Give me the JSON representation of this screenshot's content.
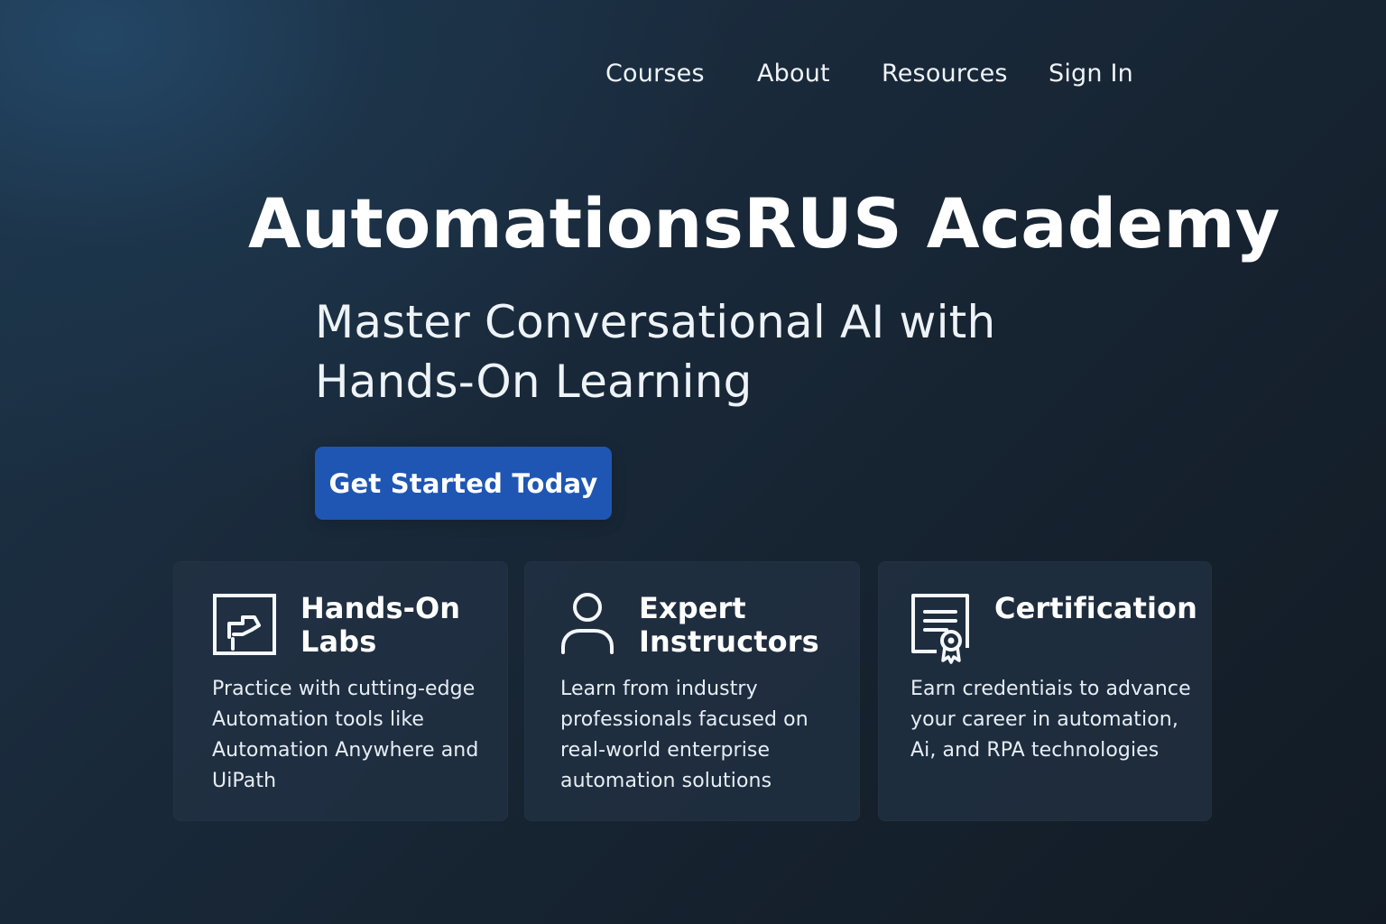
{
  "nav": {
    "items": [
      {
        "label": "Courses"
      },
      {
        "label": "About"
      },
      {
        "label": "Resources"
      },
      {
        "label": "Sign In"
      }
    ]
  },
  "hero": {
    "title": "AutomationsRUS Academy",
    "subtitle": "Master Conversational AI with Hands-On Learning",
    "cta_label": "Get Started Today"
  },
  "features": [
    {
      "icon": "lab-icon",
      "title": "Hands-On Labs",
      "description": "Practice with cutting-edge Automation tools like Automation Anywhere and UiPath"
    },
    {
      "icon": "instructor-icon",
      "title": "Expert Instructors",
      "description": "Learn from industry professionals facused on real-world enterprise automation solutions"
    },
    {
      "icon": "certificate-icon",
      "title": "Certification",
      "description": "Earn credentiais to advance your career in automation, Ai, and RPA technologies"
    }
  ],
  "colors": {
    "background": "#15212d",
    "card_background": "#223244",
    "button": "#1f56b3",
    "text": "#ffffff"
  }
}
